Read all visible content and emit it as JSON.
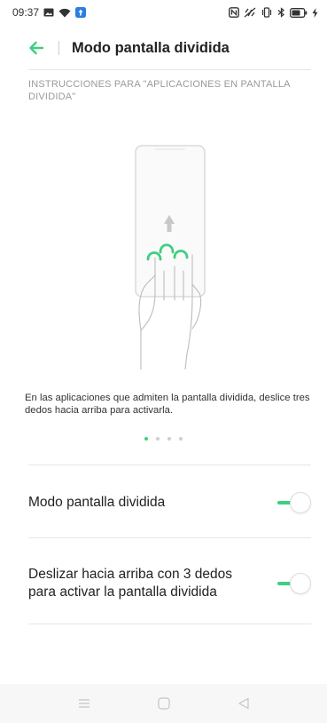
{
  "status_bar": {
    "time": "09:37",
    "left_icons": [
      "image-notification-icon",
      "wifi-icon",
      "app-notification-icon"
    ],
    "right_icons": [
      "nfc-icon",
      "vibrate-icon",
      "vibrate-mode-icon",
      "bluetooth-icon",
      "battery-icon",
      "charging-icon"
    ]
  },
  "header": {
    "back_icon": "arrow-left-icon",
    "title": "Modo pantalla dividida"
  },
  "instructions": {
    "title": "INSTRUCCIONES PARA \"APLICACIONES EN PANTALLA DIVIDIDA\"",
    "description": "En las aplicaciones que admiten la pantalla dividida, deslice tres dedos hacia arriba para activarla.",
    "page_count": 4,
    "active_page": 0
  },
  "settings": [
    {
      "label": "Modo pantalla dividida",
      "enabled": true
    },
    {
      "label": "Deslizar hacia arriba con 3 dedos para activar la pantalla dividida",
      "enabled": true
    }
  ],
  "nav_bar": {
    "icons": [
      "menu-icon",
      "home-icon",
      "back-triangle-icon"
    ]
  },
  "colors": {
    "accent": "#3ecf80",
    "divider": "#e6e6e6",
    "muted_text": "#9a9a9a"
  }
}
